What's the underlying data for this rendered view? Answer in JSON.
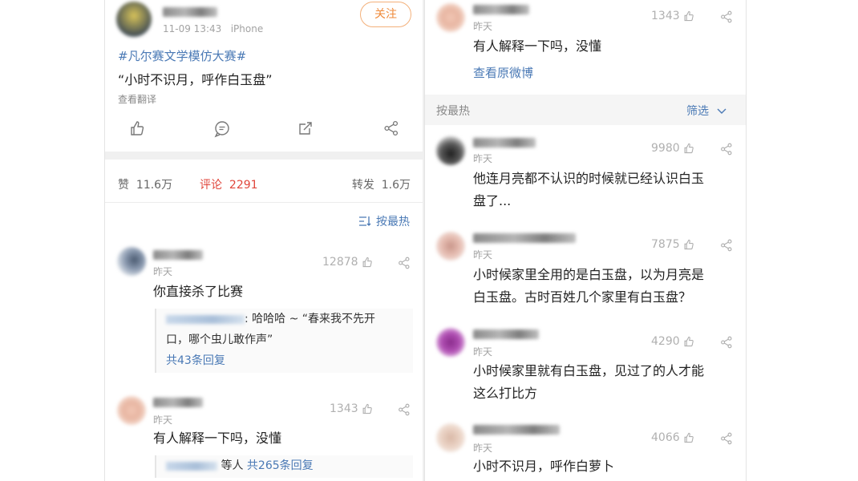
{
  "left": {
    "post": {
      "time": "11-09 13:43",
      "device": "iPhone",
      "follow_label": "关注",
      "topic": "#凡尔赛文学模仿大赛#",
      "text": "“小时不识月，呼作白玉盘”",
      "translate_label": "查看翻译"
    },
    "stats": {
      "likes_label": "赞",
      "likes_value": "11.6万",
      "comments_label": "评论",
      "comments_value": "2291",
      "reposts_label": "转发",
      "reposts_value": "1.6万"
    },
    "sort_label": "按最热",
    "comments": [
      {
        "time": "昨天",
        "likes": "12878",
        "text": "你直接杀了比赛",
        "reply_text_line1": ": 哈哈哈 ~ “春来我不先开",
        "reply_text_line2": "口，哪个虫儿敢作声”",
        "reply_more": "共43条回复"
      },
      {
        "time": "昨天",
        "likes": "1343",
        "text": "有人解释一下吗，没懂",
        "reply_more_prefix": "等人",
        "reply_more": "共265条回复"
      }
    ]
  },
  "right": {
    "top_comment": {
      "time": "昨天",
      "likes": "1343",
      "text": "有人解释一下吗，没懂",
      "view_original": "查看原微博"
    },
    "filter": {
      "sort_label": "按最热",
      "filter_label": "筛选"
    },
    "comments": [
      {
        "time": "昨天",
        "likes": "9980",
        "line1": "他连月亮都不认识的时候就已经认识白玉",
        "line2": "盘了..."
      },
      {
        "time": "昨天",
        "likes": "7875",
        "line1": "小时候家里全用的是白玉盘，以为月亮是",
        "line2": "白玉盘。古时百姓几个家里有白玉盘？"
      },
      {
        "time": "昨天",
        "likes": "4290",
        "line1": "小时候家里就有白玉盘，见过了的人才能",
        "line2": "这么打比方"
      },
      {
        "time": "昨天",
        "likes": "4066",
        "line1": "小时不识月，呼作白萝卜",
        "line2": ""
      }
    ]
  },
  "colors": {
    "link_blue": "#4a79b5",
    "follow_orange": "#ef8a3a",
    "active_red": "#e0463b"
  }
}
